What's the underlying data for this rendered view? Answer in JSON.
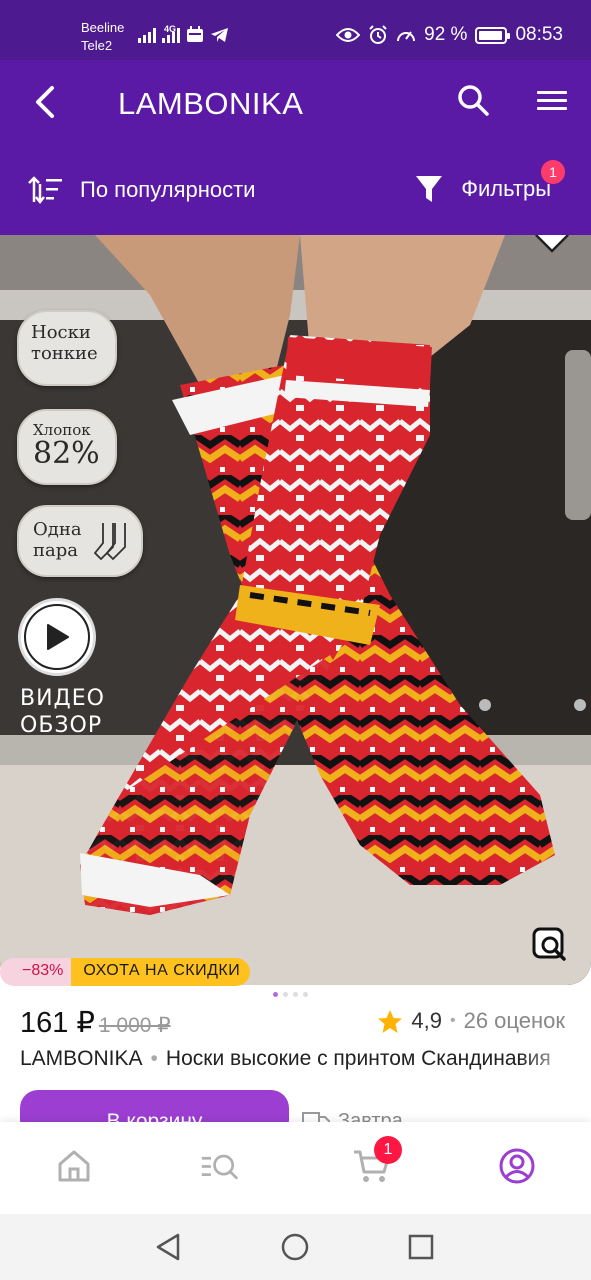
{
  "status_bar": {
    "carrier_1": "Beeline",
    "carrier_2": "Tele2",
    "network": "4G",
    "battery": "92 %",
    "battery_level": 0.92,
    "time": "08:53"
  },
  "header": {
    "title": "LAMBONIKA",
    "sort_label": "По популярности",
    "filter_label": "Фильтры",
    "filter_count": "1"
  },
  "product": {
    "features": {
      "f1_line1": "Носки",
      "f1_line2": "тонкие",
      "f2_line1": "Хлопок",
      "f2_line2": "82%",
      "f3_line1": "Одна",
      "f3_line2": "пара"
    },
    "video_line1": "ВИДЕО",
    "video_line2": "ОБЗОР",
    "discount_pct": "−83%",
    "discount_label": "ОХОТА НА СКИДКИ",
    "price": "161 ₽",
    "old_price": "1 000 ₽",
    "rating": "4,9",
    "reviews": "26 оценок",
    "brand": "LAMBONIKA",
    "name": "Носки высокие с принтом Скандинавия",
    "cart_button": "В корзину",
    "delivery": "Завтра"
  },
  "bottom_nav": {
    "cart_count": "1",
    "items": [
      "home-icon",
      "catalog-search-icon",
      "cart-icon",
      "profile-icon"
    ]
  },
  "colors": {
    "header_bg": "#5a1aa6",
    "status_bg": "#4d1a8f",
    "accent": "#9b3ed1",
    "discount_yellow": "#ffc11e",
    "badge_red": "#ff1744"
  }
}
